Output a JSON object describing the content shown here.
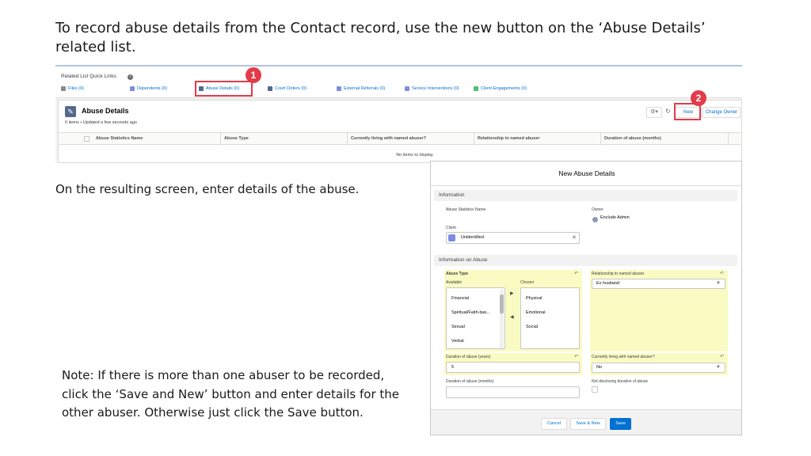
{
  "slide": {
    "heading": "To record abuse details from the Contact record, use the new button on the ‘Abuse Details’ related list.",
    "side_text": "On the resulting screen, enter details of the abuse.",
    "note_text": "Note: If there is more than one abuser to be recorded, click the ‘Save and New’ button and enter details for the other abuser. Otherwise just click the Save button."
  },
  "quick_links": {
    "title": "Related List Quick Links",
    "items": [
      {
        "label": "Files (0)",
        "color": "#8a8a8a"
      },
      {
        "label": "Dependents (0)",
        "color": "#7f8de1"
      },
      {
        "label": "Abuse Details (0)",
        "color": "#54698d"
      },
      {
        "label": "Court Orders (0)",
        "color": "#54698d"
      },
      {
        "label": "External Referrals (0)",
        "color": "#7f8de1"
      },
      {
        "label": "Service Interventions (0)",
        "color": "#7f8de1"
      },
      {
        "label": "Client Engagements (0)",
        "color": "#4bc076"
      }
    ]
  },
  "callouts": {
    "one": "1",
    "two": "2"
  },
  "abuse_details": {
    "title": "Abuse Details",
    "subtitle": "0 items • Updated a few seconds ago",
    "new_label": "New",
    "change_owner_label": "Change Owner",
    "columns": [
      "Abuse Statistics Name",
      "Abuse Type",
      "Currently living with named abuser?",
      "Relationship to named abuser",
      "Duration of abuse (months)"
    ],
    "empty_text": "No items to display."
  },
  "modal": {
    "title": "New Abuse Details",
    "section_information": "Information",
    "abuse_statistics_name_label": "Abuse Statistics Name",
    "owner_label": "Owner",
    "owner_value": "Enclude Admin",
    "client_label": "Client",
    "client_value": "Unidentified",
    "section_info_on_abuse": "Information on Abuse",
    "abuse_type_label": "Abuse Type",
    "available_label": "Available",
    "chosen_label": "Chosen",
    "available_options": [
      "Financial",
      "Spiritual/Faith-bas...",
      "Sexual",
      "Verbal"
    ],
    "chosen_options": [
      "Physical",
      "Emotional",
      "Social"
    ],
    "relationship_label": "Relationship to named abuser",
    "relationship_value": "Ex husband",
    "duration_years_label": "Duration of abuse (years)",
    "duration_years_value": "5",
    "living_label": "Currently living with named abuser?",
    "living_value": "No",
    "duration_months_label": "Duration of abuse (months)",
    "duration_months_value": "",
    "not_disclosing_label": "Not disclosing duration of abuse",
    "cancel_label": "Cancel",
    "save_new_label": "Save & New",
    "save_label": "Save"
  }
}
